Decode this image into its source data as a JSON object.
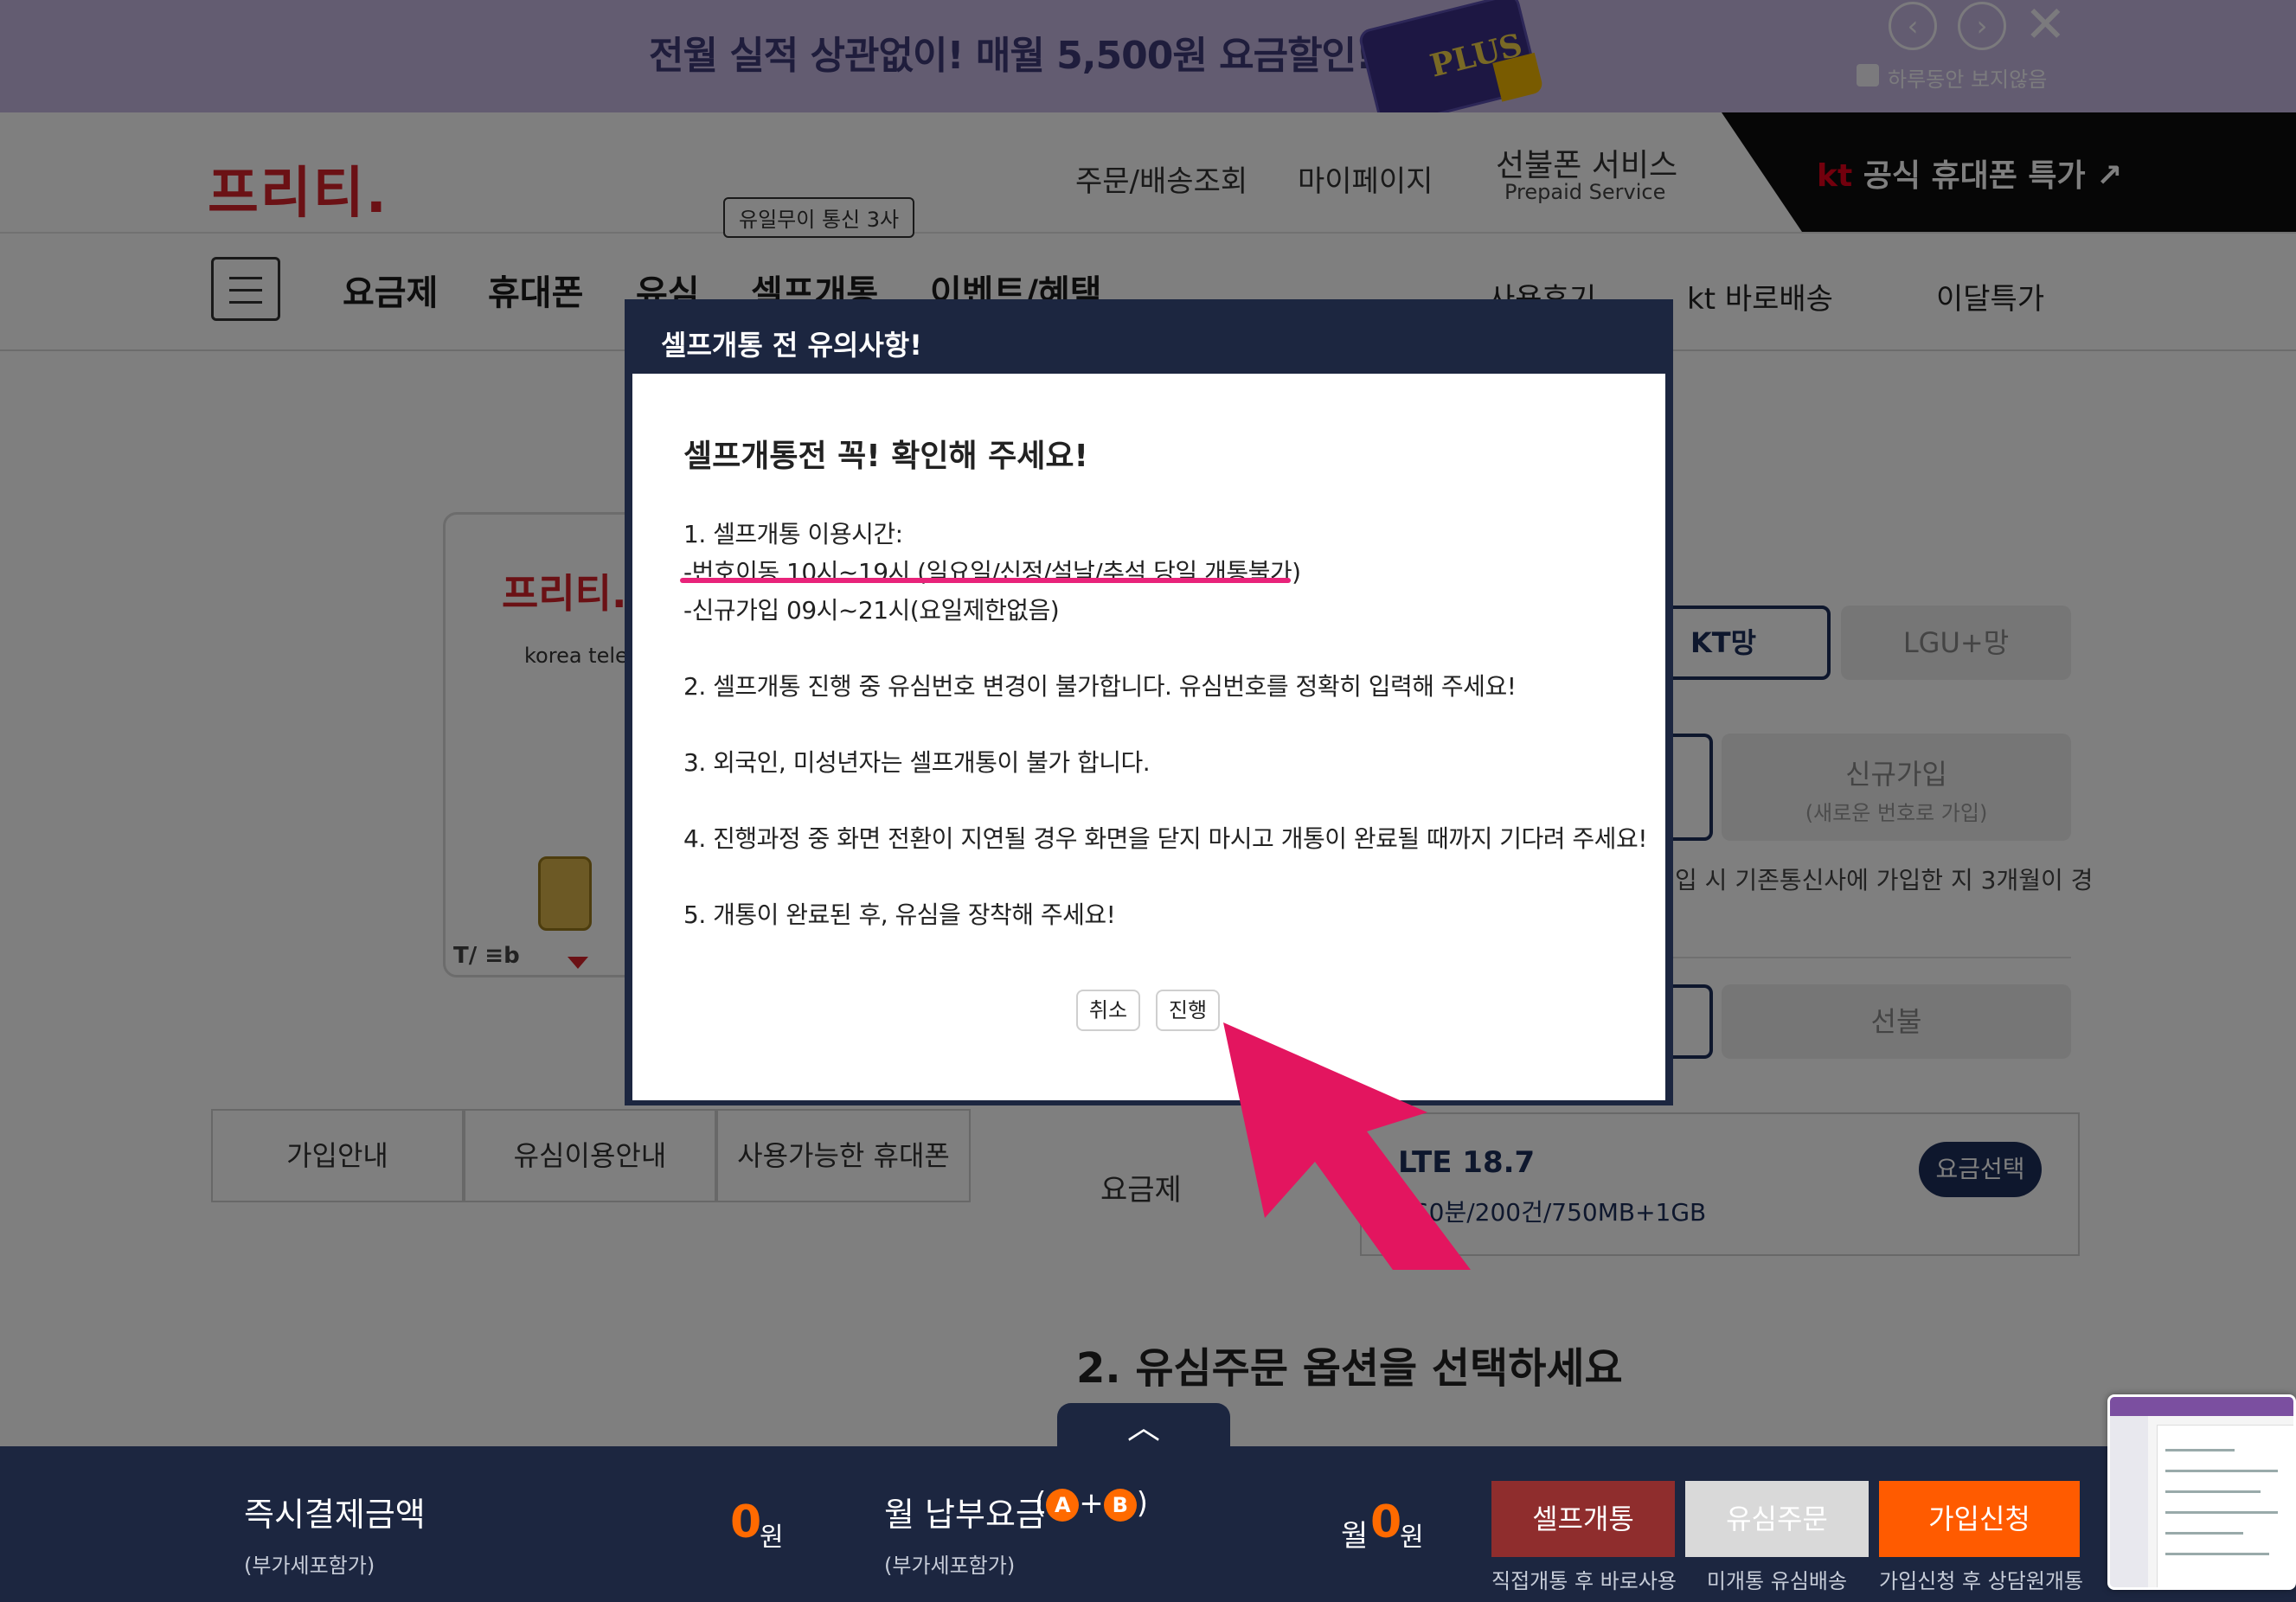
{
  "banner": {
    "text": "전월 실적 상관없이! 매월 5,500원 요금할인!",
    "card_label": "PLUS",
    "prev_icon": "‹",
    "next_icon": "›",
    "close_icon": "✕",
    "hide_today_label": "하루동안 보지않음"
  },
  "header": {
    "logo": "프리티.",
    "links": {
      "orders": "주문/배송조회",
      "mypage": "마이페이지",
      "prepaid_title": "선불폰 서비스",
      "prepaid_sub": "Prepaid Service"
    },
    "kt_promo": {
      "brand": "kt",
      "text": "공식 휴대폰 특가",
      "arrow": "↗"
    }
  },
  "nav": {
    "items": {
      "plans": "요금제",
      "phones": "휴대폰",
      "usim": "유심",
      "self": "셀프개통",
      "events": "이벤트/혜택"
    },
    "tag": "유일무이 통신 3사",
    "right": {
      "reviews": "사용후기",
      "delivery": "kt 바로배송",
      "monthly": "이달특가"
    }
  },
  "product": {
    "card_logo": "프리티.",
    "card_sub": "korea telec",
    "brand_mark": "T/ ≡b"
  },
  "tabs": {
    "join": "가입안내",
    "usim": "유심이용안내",
    "phones": "사용가능한 휴대폰"
  },
  "options": {
    "kt": "KT망",
    "lgu": "LGU+망",
    "new_label": "신규가입",
    "new_sub": "(새로운 번호로 가입)",
    "port_notice": "입 시 기존통신사에 가입한 지 3개월이 경",
    "prepaid": "선불"
  },
  "plan": {
    "label": "요금제",
    "name": "LTE 18.7",
    "detail": "160분/200건/750MB+1GB",
    "select": "요금선택"
  },
  "section2": "2. 유심주문 옵션을 선택하세요",
  "modal": {
    "title": "셀프개통 전 유의사항!",
    "heading": "셀프개통전 꼭! 확인해 주세요!",
    "lines": [
      "1. 셀프개통 이용시간:",
      "-번호이동 10시~19시 (일요일/신정/설날/추석 당일 개통불가)",
      "-신규가입 09시~21시(요일제한없음)",
      "2. 셀프개통 진행 중 유심번호 변경이 불가합니다. 유심번호를 정확히 입력해 주세요!",
      "3. 외국인, 미성년자는 셀프개통이 불가 합니다.",
      "4. 진행과정 중 화면 전환이 지연될 경우 화면을 닫지 마시고 개통이 완료될 때까지 기다려 주세요!",
      "5. 개통이 완료된 후, 유심을 장착해 주세요!"
    ],
    "cancel": "취소",
    "proceed": "진행"
  },
  "bottom_bar": {
    "collapse_icon": "︿",
    "pay_now_label": "즉시결제금액",
    "pay_now_sub": "(부가세포함가)",
    "pay_now_amount": "0",
    "currency": "원",
    "monthly_label": "월 납부요금",
    "monthly_a": "A",
    "monthly_b": "B",
    "monthly_sub": "(부가세포함가)",
    "monthly_prefix": "월",
    "monthly_amount": "0",
    "cta_self": "셀프개통",
    "cta_self_sub": "직접개통 후 바로사용",
    "cta_usim": "유심주문",
    "cta_usim_sub": "미개통 유심배송",
    "cta_apply": "가입신청",
    "cta_apply_sub": "가입신청 후 상담원개통"
  },
  "colors": {
    "brand_red": "#d6232a",
    "navy": "#1c2640",
    "highlight_pink": "#e8237a",
    "accent_orange": "#ff5b00"
  },
  "icons": {
    "menu": "hamburger-icon",
    "annotation": "pink-arrow-icon"
  }
}
